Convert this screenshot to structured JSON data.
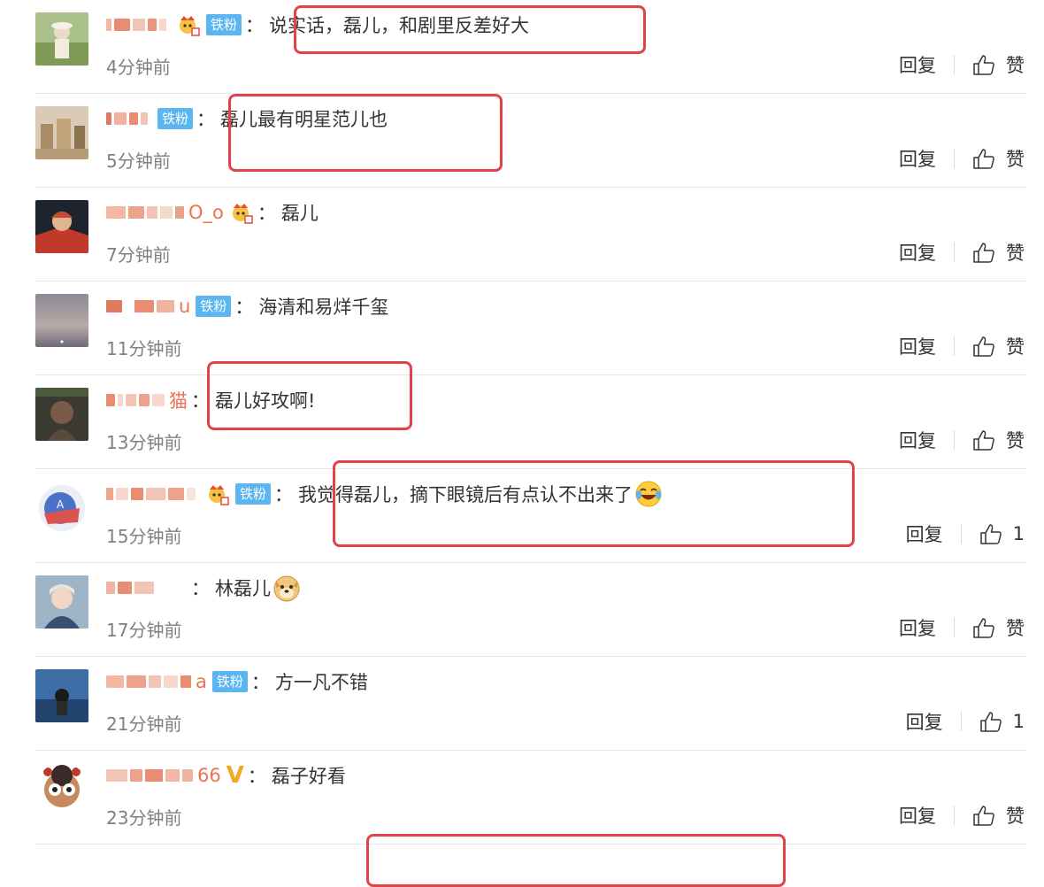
{
  "comments": [
    {
      "suffix": "",
      "badge": "crown+fan",
      "text": "说实话，磊儿，和剧里反差好大",
      "emoji": "",
      "time": "4分钟前",
      "like": "赞"
    },
    {
      "suffix": "",
      "badge": "fan",
      "text": "磊儿最有明星范儿也",
      "emoji": "",
      "time": "5分钟前",
      "like": "赞"
    },
    {
      "suffix": "O_o",
      "badge": "crown",
      "text": "磊儿",
      "emoji": "",
      "time": "7分钟前",
      "like": "赞"
    },
    {
      "suffix": "u",
      "badge": "fan",
      "text": "海清和易烊千玺",
      "emoji": "",
      "time": "11分钟前",
      "like": "赞"
    },
    {
      "suffix": "猫",
      "badge": "",
      "text": "磊儿好攻啊!",
      "emoji": "",
      "time": "13分钟前",
      "like": "赞"
    },
    {
      "suffix": "",
      "badge": "crown+fan",
      "text": "我觉得磊儿，摘下眼镜后有点认不出来了",
      "emoji": "laughing-tears",
      "time": "15分钟前",
      "like": "1"
    },
    {
      "suffix": "",
      "badge": "",
      "text": "林磊儿",
      "emoji": "doge",
      "time": "17分钟前",
      "like": "赞"
    },
    {
      "suffix": "a",
      "badge": "fan",
      "text": "方一凡不错",
      "emoji": "",
      "time": "21分钟前",
      "like": "1"
    },
    {
      "suffix": "66",
      "badge": "v",
      "text": "磊子好看",
      "emoji": "",
      "time": "23分钟前",
      "like": "赞"
    }
  ],
  "labels": {
    "reply": "回复",
    "fan_badge": "铁粉",
    "colon": "："
  },
  "colors": {
    "highlight": "#e0434a",
    "fan_badge": "#5bb5f0",
    "username": "#eb7350",
    "time": "#808080"
  }
}
